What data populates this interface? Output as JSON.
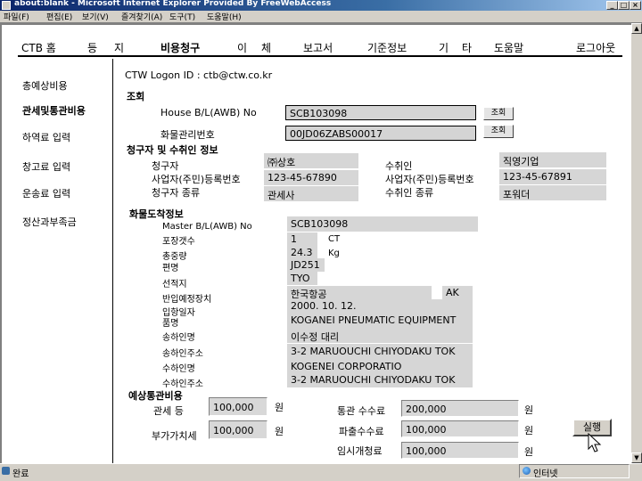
{
  "window": {
    "title": "about:blank - Microsoft Internet Explorer Provided By FreeWebAccess"
  },
  "menubar": [
    "파일(F)",
    "편집(E)",
    "보기(V)",
    "즐겨찾기(A)",
    "도구(T)",
    "도움말(H)"
  ],
  "topnav": [
    {
      "label": "CTB 홈",
      "active": false
    },
    {
      "label": "등",
      "active": false
    },
    {
      "label": "지",
      "active": false
    },
    {
      "label": "비용청구",
      "active": true
    },
    {
      "label": "이",
      "active": false
    },
    {
      "label": "체",
      "active": false
    },
    {
      "label": "보고서",
      "active": false
    },
    {
      "label": "기준정보",
      "active": false
    },
    {
      "label": "기",
      "active": false
    },
    {
      "label": "타",
      "active": false
    },
    {
      "label": "도움말",
      "active": false
    },
    {
      "label": "로그아웃",
      "active": false
    }
  ],
  "sidebar": [
    {
      "label": "총예상비용",
      "active": false
    },
    {
      "label": "관세및통관비용",
      "active": true
    },
    {
      "label": "하역료 입력",
      "active": false
    },
    {
      "label": "창고료 입력",
      "active": false
    },
    {
      "label": "운송료 입력",
      "active": false
    },
    {
      "label": "정산과부족금",
      "active": false
    }
  ],
  "logon": "CTW Logon ID : ctb@ctw.co.kr",
  "search": {
    "heading": "조회",
    "house_bl_label": "House B/L(AWB) No",
    "house_bl_value": "SCB103098",
    "cargo_no_label": "화물관리번호",
    "cargo_no_value": "00JD06ZABS00017",
    "button_label": "조회"
  },
  "parties": {
    "heading": "청구자 및 수취인 정보",
    "claimant_label": "청구자",
    "claimant_value": "㈜상호",
    "claimant_reg_label": "사업자(주민)등록번호",
    "claimant_reg_value": "123-45-67890",
    "claimant_type_label": "청구자 종류",
    "claimant_type_value": "관세사",
    "payee_label": "수취인",
    "payee_value": "직영기업",
    "payee_reg_label": "사업자(주민)등록번호",
    "payee_reg_value": "123-45-67891",
    "payee_type_label": "수취인 종류",
    "payee_type_value": "포워더"
  },
  "arrival": {
    "heading": "화물도착정보",
    "master_bl_label": "Master B/L(AWB) No",
    "master_bl_value": "SCB103098",
    "packages_label": "포장갯수",
    "packages_value": "1",
    "packages_unit": "CT",
    "weight_label": "총중량",
    "weight_value": "24.3",
    "weight_unit": "Kg",
    "flight_label": "편명",
    "flight_value": "JD251",
    "loading_label": "선적지",
    "loading_value": "TYO",
    "warehouse_label": "반입예정장치",
    "warehouse_value": "한국항공",
    "warehouse_code": "AK",
    "arrival_date_label": "입항일자",
    "arrival_date_value": "2000. 10. 12.",
    "item_label": "품명",
    "item_value": "KOGANEI PNEUMATIC EQUIPMENT",
    "shipper_label": "송하인명",
    "shipper_value": "이수정 대리",
    "shipper_addr_label": "송하인주소",
    "shipper_addr_value": "3-2 MARUOUCHI CHIYODAKU TOK",
    "consignee_label": "수하인명",
    "consignee_value": "KOGENEI CORPORATIO",
    "consignee_addr_label": "수하인주소",
    "consignee_addr_value": "3-2 MARUOUCHI CHIYODAKU TOK"
  },
  "costs": {
    "heading": "예상통관비용",
    "customs_label": "관세 등",
    "customs_value": "100,000",
    "vat_label": "부가가치세",
    "vat_value": "100,000",
    "clearance_label": "통관 수수료",
    "clearance_value": "200,000",
    "agent_label": "파출수수료",
    "agent_value": "100,000",
    "temp_label": "임시개청료",
    "temp_value": "100,000",
    "currency": "원"
  },
  "execute_label": "실행",
  "status": {
    "left": "완료",
    "zone": "인터넷"
  }
}
